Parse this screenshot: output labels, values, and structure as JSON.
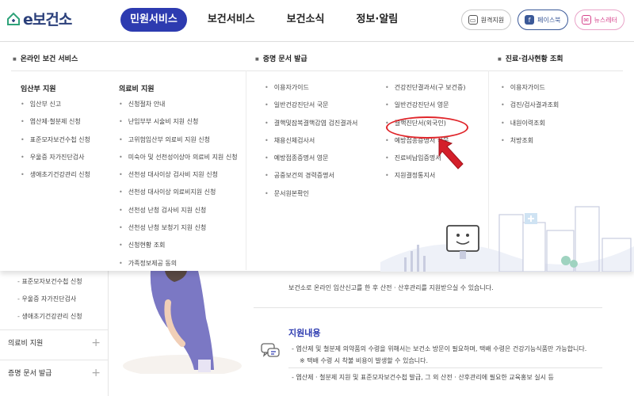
{
  "brand": {
    "logo_text": "e보건소",
    "primary_color": "#2d3bb0",
    "alert_color": "#e0262b"
  },
  "nav": {
    "items": [
      {
        "label": "민원서비스",
        "active": true
      },
      {
        "label": "보건서비스",
        "active": false
      },
      {
        "label": "보건소식",
        "active": false
      },
      {
        "label": "정보·알림",
        "active": false
      }
    ]
  },
  "util": {
    "remote": "원격지원",
    "facebook": "페이스북",
    "newsletter": "뉴스레터"
  },
  "mega": {
    "col1": {
      "head": "온라인 보건 서비스",
      "groups": [
        {
          "title": "임산부 지원",
          "items": [
            "임산부 신고",
            "엽산제·철분제 신청",
            "표준모자보건수첩 신청",
            "우울증 자가진단검사",
            "생애초기건강관리 신청"
          ]
        },
        {
          "title": "의료비 지원",
          "items": [
            "신청절차 안내",
            "난임부부 시술비 지원 신청",
            "고위험임산부 의료비 지원 신청",
            "미숙아 및 선천성이상아 의료비 지원 신청",
            "선천성 대사이상 검사비 지원 신청",
            "선천성 대사이상 의료비지원 신청",
            "선천성 난청 검사비 지원 신청",
            "선천성 난청 보청기 지원 신청",
            "신청현황 조회",
            "가족정보제공 동의"
          ]
        }
      ]
    },
    "col2": {
      "head": "증명 문서 발급",
      "left_items": [
        "이용자가이드",
        "일반건강진단서 국문",
        "결핵및잠복결핵감염 검진결과서",
        "채용신체검사서",
        "예방접종증명서 영문",
        "공중보건의 경력증명서",
        "문서원본확인"
      ],
      "right_items": [
        "건강진단결과서(구 보건증)",
        "일반건강진단서 영문",
        "결핵진단서(외국인)",
        "예방접종증명서 국문",
        "진료비납입증명서",
        "지원결정통지서"
      ]
    },
    "col3": {
      "head": "진료·검사현황 조회",
      "items": [
        "이용자가이드",
        "검진/검사결과조회",
        "내원이력조회",
        "처방조회"
      ]
    }
  },
  "sidebar": {
    "sub_items": [
      "표준모자보건수첩 신청",
      "우울증 자가진단검사",
      "생애초기건강관리 신청"
    ],
    "menu": [
      {
        "label": "의료비 지원"
      },
      {
        "label": "증명 문서 발급"
      }
    ]
  },
  "content": {
    "intro": "보건소로 온라인 임산신고를 한 후 산전 · 산후관리를 지원받으실 수 있습니다.",
    "section_title": "지원내용",
    "bullet1": "엽산제 및 철분제 의약품의 수령을 위해서는 보건소 방문이 필요하며, 택배 수령은 건강기능식품만 가능합니다.",
    "bullet1_note": "※ 택배 수령 시 착불 비용이 발생할 수 있습니다.",
    "bullet2": "엽산제 · 철분제 지원 및 표준모자보건수첩 발급, 그 외 산전 · 산후관리에 필요한 교육홍보 실시 등"
  }
}
